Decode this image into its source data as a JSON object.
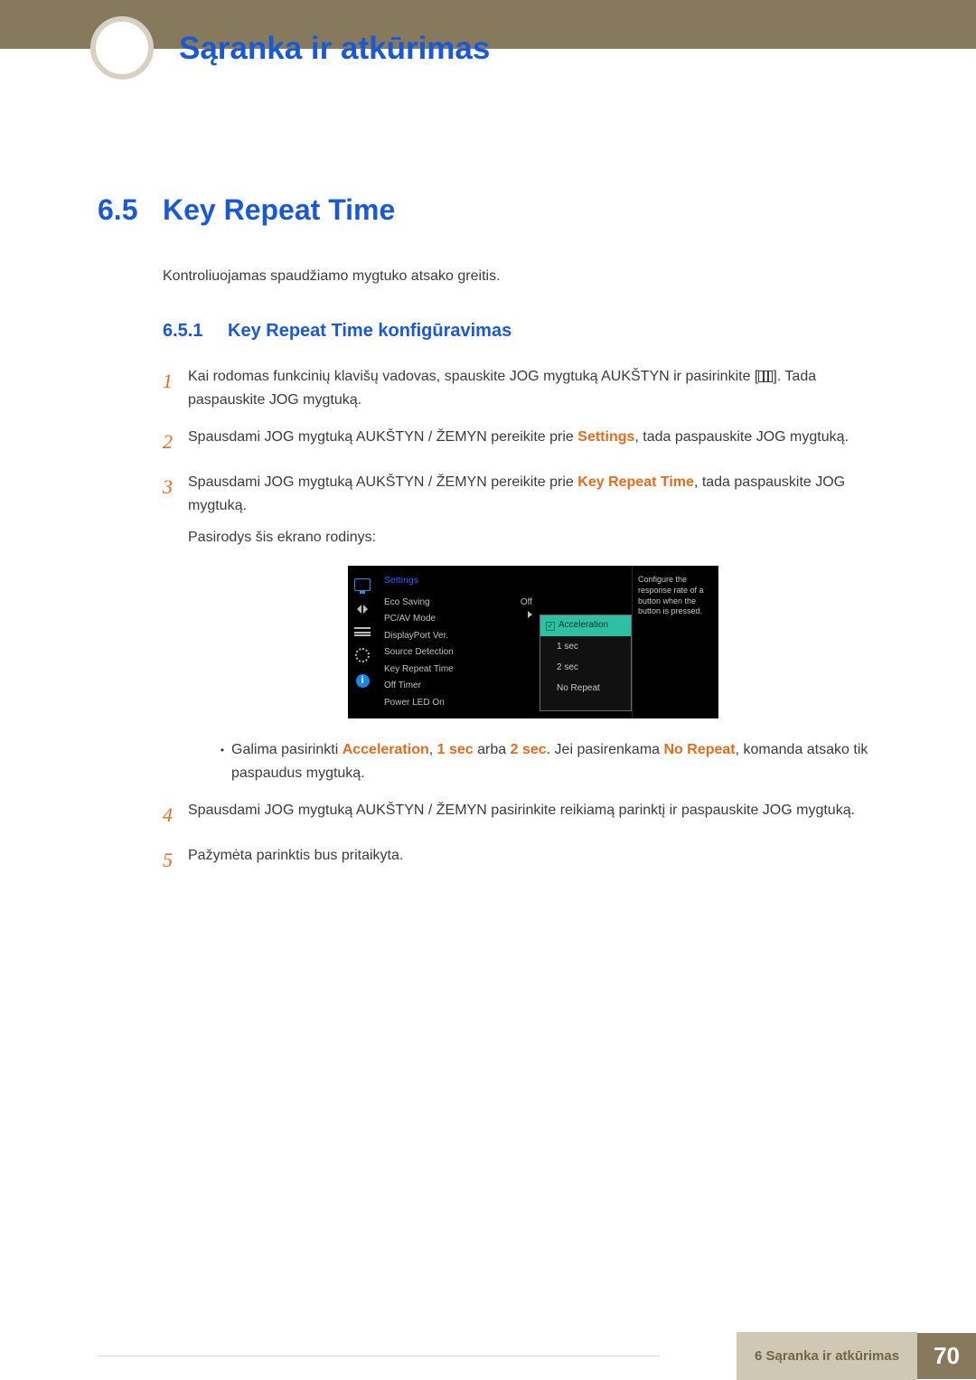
{
  "header": {
    "chapter_title": "Sąranka ir atkūrimas"
  },
  "section": {
    "number": "6.5",
    "title": "Key Repeat Time",
    "intro": "Kontroliuojamas spaudžiamo mygtuko atsako greitis."
  },
  "subsection": {
    "number": "6.5.1",
    "title": "Key Repeat Time konfigūravimas"
  },
  "steps": {
    "s1": {
      "num": "1",
      "a": "Kai rodomas funkcinių klavišų vadovas, spauskite JOG mygtuką AUKŠTYN ir pasirinkite [",
      "b": "]. Tada paspauskite JOG mygtuką."
    },
    "s2": {
      "num": "2",
      "a": "Spausdami JOG mygtuką AUKŠTYN / ŽEMYN pereikite prie ",
      "hl": "Settings",
      "b": ", tada paspauskite JOG mygtuką."
    },
    "s3": {
      "num": "3",
      "a": "Spausdami JOG mygtuką AUKŠTYN / ŽEMYN pereikite prie ",
      "hl": "Key Repeat Time",
      "b": ", tada paspauskite JOG mygtuką.",
      "note": "Pasirodys šis ekrano rodinys:"
    },
    "bullet": {
      "a": "Galima pasirinkti ",
      "hl1": "Acceleration",
      "mid1": ", ",
      "hl2": "1 sec",
      "mid2": " arba ",
      "hl3": "2 sec",
      "mid3": ". Jei pasirenkama ",
      "hl4": "No Repeat",
      "b": ", komanda atsako tik paspaudus mygtuką."
    },
    "s4": {
      "num": "4",
      "text": "Spausdami JOG mygtuką AUKŠTYN / ŽEMYN pasirinkite reikiamą parinktį ir paspauskite JOG mygtuką."
    },
    "s5": {
      "num": "5",
      "text": "Pažymėta parinktis bus pritaikyta."
    }
  },
  "osd": {
    "title": "Settings",
    "rows": {
      "eco_saving": "Eco Saving",
      "eco_saving_val": "Off",
      "pc_av": "PC/AV Mode",
      "dp_ver": "DisplayPort Ver.",
      "src_det": "Source Detection",
      "krt": "Key Repeat Time",
      "off_timer": "Off Timer",
      "power_led": "Power LED On"
    },
    "popup": {
      "sel": "Acceleration",
      "opt1": "1 sec",
      "opt2": "2 sec",
      "opt3": "No Repeat"
    },
    "tip": "Configure the response rate of a button when the button is pressed."
  },
  "footer": {
    "label": "6 Sąranka ir atkūrimas",
    "page": "70"
  }
}
